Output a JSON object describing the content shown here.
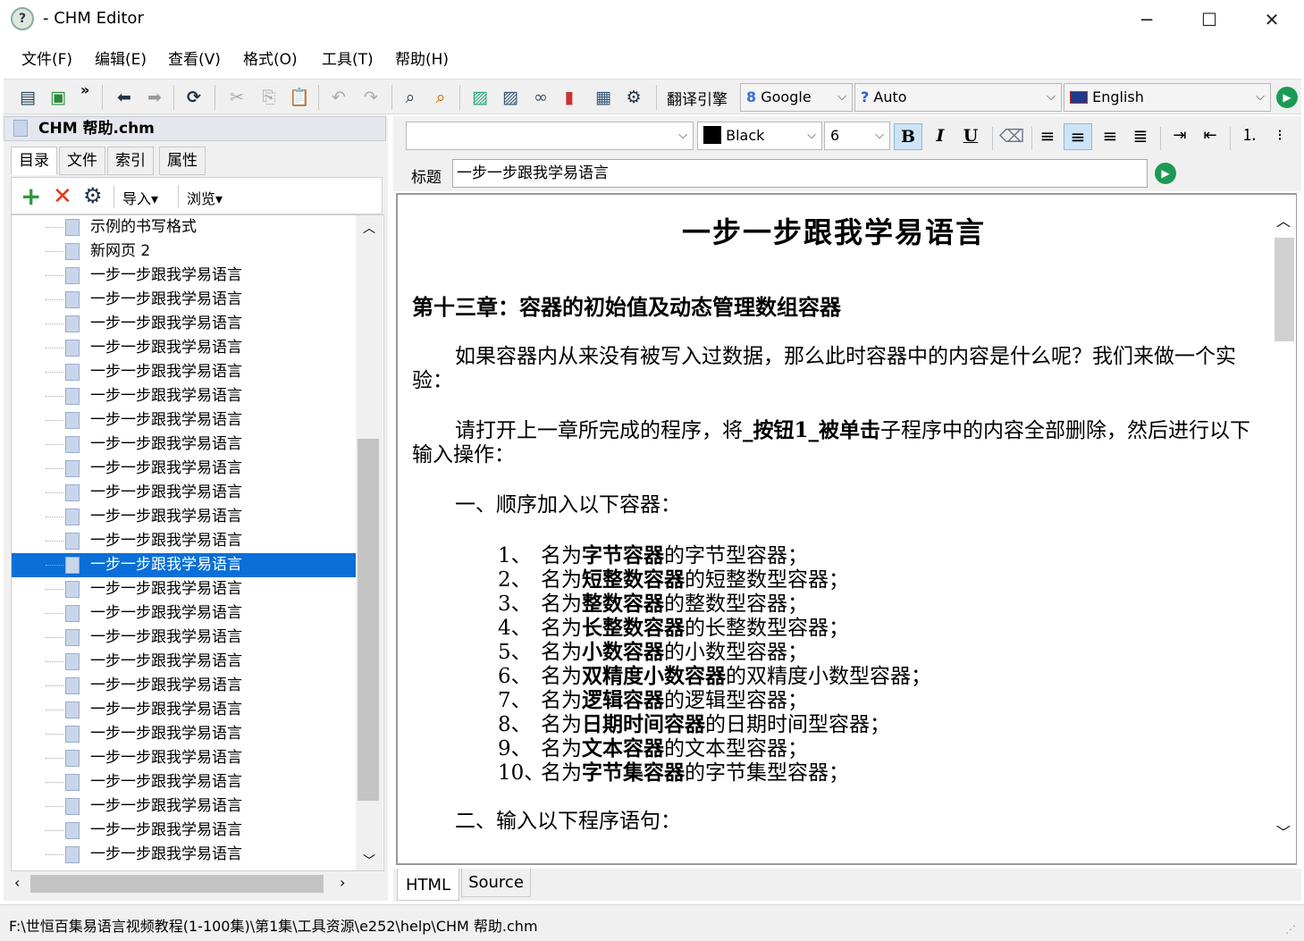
{
  "window": {
    "title": "- CHM Editor",
    "minimize": "─",
    "maximize": "☐",
    "close": "✕"
  },
  "menu": [
    "文件(F)",
    "编辑(E)",
    "查看(V)",
    "格式(O)",
    "工具(T)",
    "帮助(H)"
  ],
  "toolbar": {
    "translate_label": "翻译引擎",
    "engine": "Google",
    "source_lang": "Auto",
    "target_lang": "English",
    "more": "»"
  },
  "left": {
    "file_title": "CHM 帮助.chm",
    "tabs": [
      "目录",
      "文件",
      "索引",
      "属性"
    ],
    "import_label": "导入▾",
    "browse_label": "浏览▾",
    "tree": [
      "示例的书写格式",
      "新网页 2",
      "一步一步跟我学易语言",
      "一步一步跟我学易语言",
      "一步一步跟我学易语言",
      "一步一步跟我学易语言",
      "一步一步跟我学易语言",
      "一步一步跟我学易语言",
      "一步一步跟我学易语言",
      "一步一步跟我学易语言",
      "一步一步跟我学易语言",
      "一步一步跟我学易语言",
      "一步一步跟我学易语言",
      "一步一步跟我学易语言",
      "一步一步跟我学易语言",
      "一步一步跟我学易语言",
      "一步一步跟我学易语言",
      "一步一步跟我学易语言",
      "一步一步跟我学易语言",
      "一步一步跟我学易语言",
      "一步一步跟我学易语言",
      "一步一步跟我学易语言",
      "一步一步跟我学易语言",
      "一步一步跟我学易语言",
      "一步一步跟我学易语言",
      "一步一步跟我学易语言",
      "一步一步跟我学易语言"
    ],
    "selected_index": 14
  },
  "format": {
    "font": "",
    "color_name": "Black",
    "color": "#000000",
    "size": "6",
    "bold": "B",
    "italic": "I",
    "underline": "U"
  },
  "title_field": {
    "label": "标题",
    "value": "一步一步跟我学易语言"
  },
  "content": {
    "heading": "一步一步跟我学易语言",
    "chapter": "第十三章：容器的初始值及动态管理数组容器",
    "p1": "如果容器内从来没有被写入过数据，那么此时容器中的内容是什么呢？我们来做一个实验：",
    "p2_a": "请打开上一章所完成的程序，将",
    "p2_b": "_按钮1_被单击",
    "p2_c": "子程序中的内容全部删除，然后进行以下输入操作：",
    "s1": "一、顺序加入以下容器：",
    "items": [
      {
        "n": "1、",
        "pre": "名为",
        "b": "字节容器",
        "post": "的字节型容器；"
      },
      {
        "n": "2、",
        "pre": "名为",
        "b": "短整数容器",
        "post": "的短整数型容器；"
      },
      {
        "n": "3、",
        "pre": "名为",
        "b": "整数容器",
        "post": "的整数型容器；"
      },
      {
        "n": "4、",
        "pre": "名为",
        "b": "长整数容器",
        "post": "的长整数型容器；"
      },
      {
        "n": "5、",
        "pre": "名为",
        "b": "小数容器",
        "post": "的小数型容器；"
      },
      {
        "n": "6、",
        "pre": "名为",
        "b": "双精度小数容器",
        "post": "的双精度小数型容器；"
      },
      {
        "n": "7、",
        "pre": "名为",
        "b": "逻辑容器",
        "post": "的逻辑型容器；"
      },
      {
        "n": "8、",
        "pre": "名为",
        "b": "日期时间容器",
        "post": "的日期时间型容器；"
      },
      {
        "n": "9、",
        "pre": "名为",
        "b": "文本容器",
        "post": "的文本型容器；"
      },
      {
        "n": "10、",
        "pre": "名为",
        "b": "字节集容器",
        "post": "的字节集型容器；"
      }
    ],
    "s2": "二、输入以下程序语句："
  },
  "bottom_tabs": [
    "HTML",
    "Source"
  ],
  "status": "F:\\世恒百集易语言视频教程(1-100集)\\第1集\\工具资源\\e252\\help\\CHM 帮助.chm"
}
